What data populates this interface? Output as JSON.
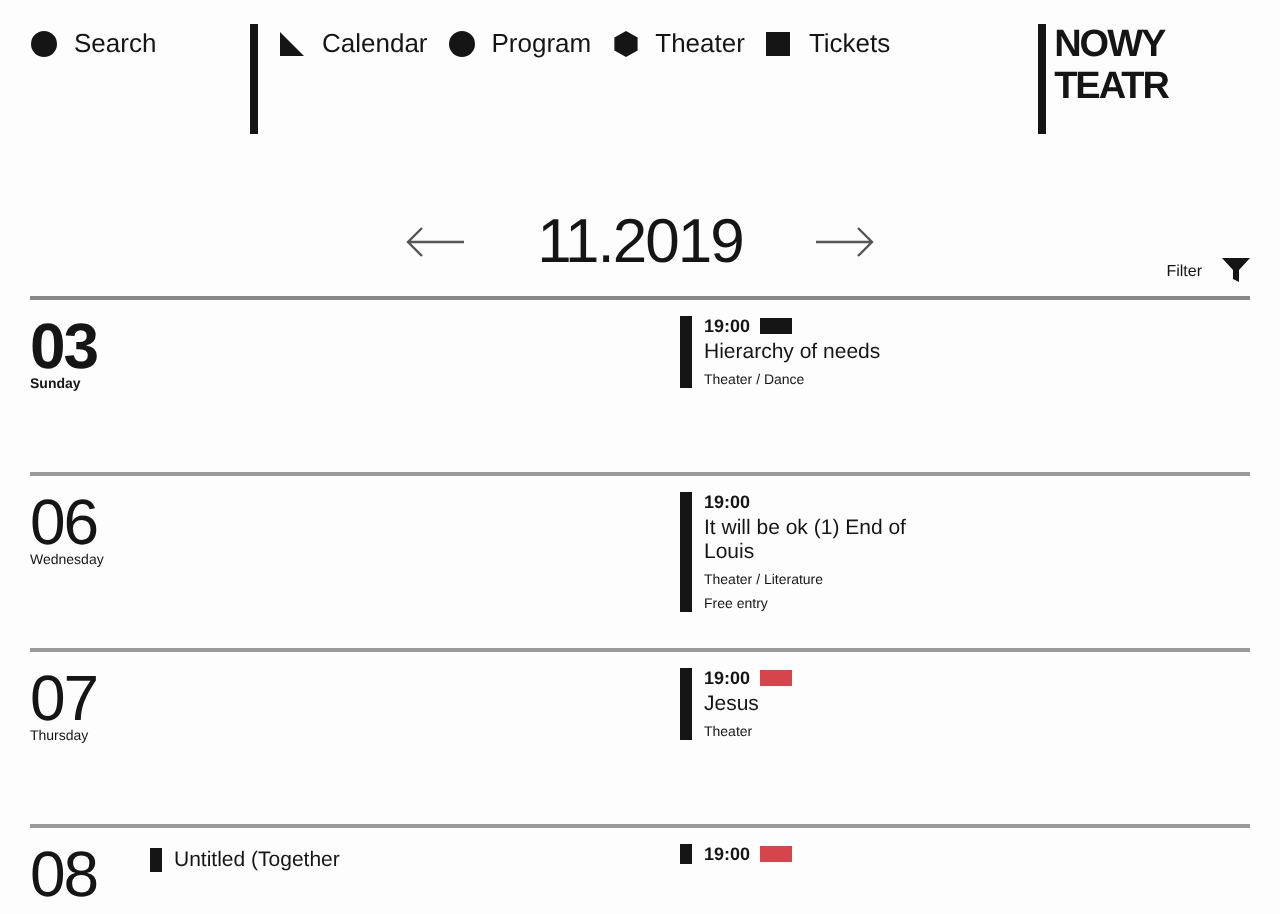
{
  "header": {
    "search": "Search",
    "nav": [
      {
        "label": "Calendar"
      },
      {
        "label": "Program"
      },
      {
        "label": "Theater"
      },
      {
        "label": "Tickets"
      }
    ],
    "logo": [
      "NOWY",
      "TEATR"
    ]
  },
  "month": {
    "label": "11.2019"
  },
  "filter": "Filter",
  "days": [
    {
      "day": "03",
      "weekday": "Sunday",
      "selected": true,
      "column_2": [
        {
          "time": "19:00",
          "color": "#151515",
          "title": "Hierarchy of needs",
          "tags": [
            "Theater / Dance"
          ]
        }
      ]
    },
    {
      "day": "06",
      "weekday": "Wednesday",
      "selected": false,
      "column_2": [
        {
          "time": "19:00",
          "title": "It will be ok (1) End of Louis",
          "tags": [
            "Theater / Literature",
            "Free entry"
          ]
        }
      ]
    },
    {
      "day": "07",
      "weekday": "Thursday",
      "selected": false,
      "column_2": [
        {
          "time": "19:00",
          "color": "#d6454b",
          "title": "Jesus",
          "tags": [
            "Theater"
          ]
        }
      ]
    },
    {
      "day": "08",
      "selected": false,
      "column_1": [
        {
          "title": "Untitled (Together"
        }
      ],
      "column_2": [
        {
          "time": "19:00",
          "color": "#d6454b"
        }
      ]
    }
  ]
}
